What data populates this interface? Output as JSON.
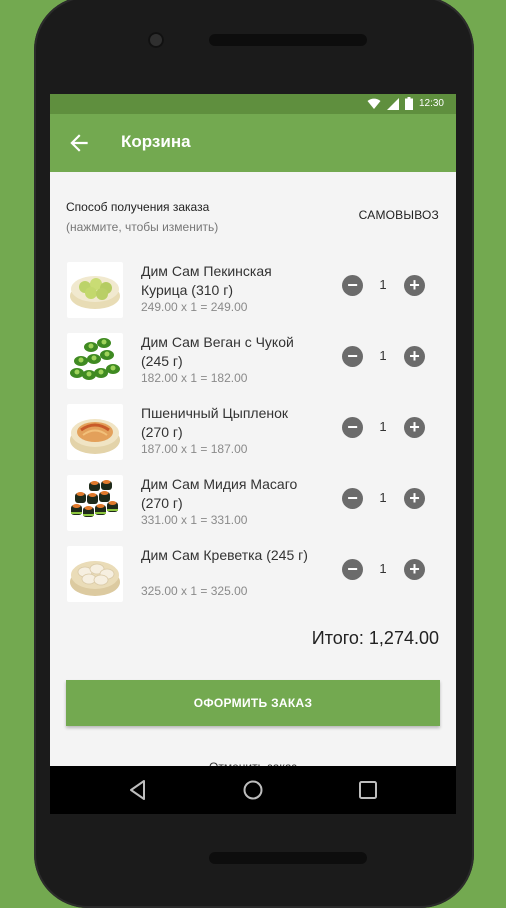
{
  "status_bar": {
    "time": "12:30"
  },
  "toolbar": {
    "title": "Корзина"
  },
  "delivery": {
    "label": "Способ получения заказа",
    "hint": "(нажмите, чтобы изменить)",
    "value": "САМОВЫВОЗ"
  },
  "cart": {
    "items": [
      {
        "name": "Дим Сам Пекинская Курица (310 г)",
        "price_line": "249.00 x 1 = 249.00",
        "qty": "1",
        "minus": "−",
        "plus": "+"
      },
      {
        "name": "Дим Сам Веган с Чукой (245 г)",
        "price_line": "182.00 x 1 = 182.00",
        "qty": "1",
        "minus": "−",
        "plus": "+"
      },
      {
        "name": "Пшеничный Цыпленок (270 г)",
        "price_line": "187.00 x 1 = 187.00",
        "qty": "1",
        "minus": "−",
        "plus": "+"
      },
      {
        "name": "Дим Сам Мидия Масаго (270 г)",
        "price_line": "331.00 x 1 = 331.00",
        "qty": "1",
        "minus": "−",
        "plus": "+"
      },
      {
        "name": "Дим Сам Креветка (245 г)",
        "price_line": "325.00 x 1 = 325.00",
        "qty": "1",
        "minus": "−",
        "plus": "+"
      }
    ],
    "total": "Итого: 1,274.00"
  },
  "actions": {
    "checkout_label": "ОФОРМИТЬ ЗАКАЗ",
    "cancel_label": "Отменить заказ"
  },
  "colors": {
    "accent": "#73a950",
    "accent_dark": "#5f8f3e",
    "background": "#f4f4f4"
  },
  "icons": {
    "back": "arrow-left-icon",
    "wifi": "wifi-icon",
    "signal": "signal-icon",
    "battery": "battery-icon",
    "nav_back": "triangle-back-icon",
    "nav_home": "circle-home-icon",
    "nav_recent": "square-recent-icon"
  }
}
